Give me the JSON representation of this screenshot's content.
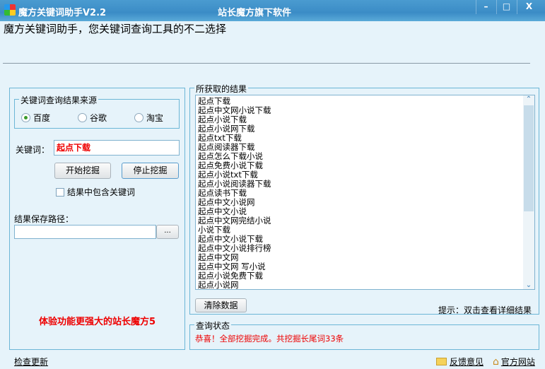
{
  "window": {
    "title": "魔方关键词助手V2.2",
    "subtitle": "站长魔方旗下软件",
    "controls": {
      "minimize": "–",
      "maximize": "□",
      "close": "X"
    }
  },
  "tagline": "魔方关键词助手，您关键词查询工具的不二选择",
  "left": {
    "source_group": {
      "label": "关键词查询结果来源",
      "options": [
        {
          "label": "百度",
          "checked": true
        },
        {
          "label": "谷歌",
          "checked": false
        },
        {
          "label": "淘宝",
          "checked": false
        }
      ]
    },
    "keyword_label": "关键词：",
    "keyword_value": "起点下载",
    "start_button": "开始挖掘",
    "stop_button": "停止挖掘",
    "include_keyword": {
      "label": "结果中包含关键词",
      "checked": false
    },
    "save_path_label": "结果保存路径：",
    "save_path_value": "",
    "browse_button": "...",
    "promo": "体验功能更强大的站长魔方5"
  },
  "results": {
    "label": "所获取的结果",
    "items": [
      "起点下载",
      "起点中文网小说下载",
      "起点小说下载",
      "起点小说网下载",
      "起点txt下载",
      "起点阅读器下载",
      "起点怎么下载小说",
      "起点免费小说下载",
      "起点小说txt下载",
      "起点小说阅读器下载",
      "起点读书下载",
      "起点中文小说网",
      "起点中文小说",
      "起点中文网完结小说",
      "小说下载",
      "起点中文小说下载",
      "起点中文小说排行榜",
      "起点中文网",
      "起点中文网 写小说",
      "起点小说免费下载",
      "起点小说网"
    ],
    "clear_button": "清除数据",
    "hint": "提示：双击查看详细结果"
  },
  "status": {
    "label": "查询状态",
    "message": "恭喜！全部挖掘完成。共挖掘长尾词33条"
  },
  "footer": {
    "check_update": "检查更新",
    "feedback": "反馈意见",
    "website": "官方网站"
  },
  "colors": {
    "accent_red": "#e00000",
    "titlebar": "#3b8cc6",
    "background": "#e6f3fa"
  }
}
